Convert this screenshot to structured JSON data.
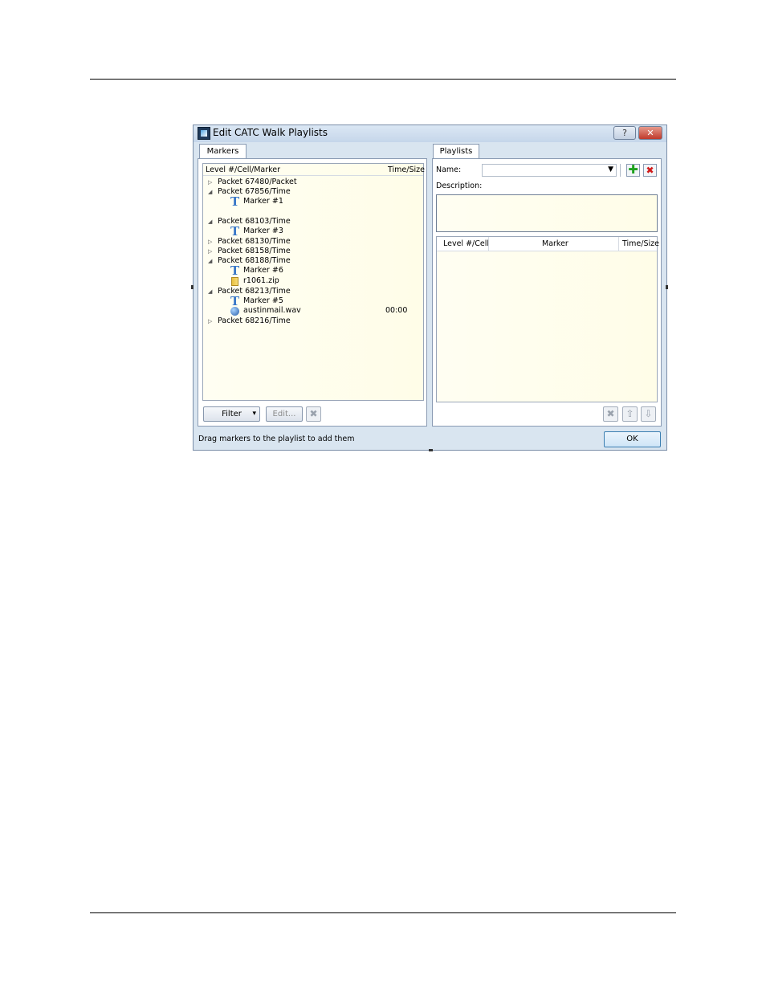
{
  "window": {
    "title": "Edit CATC Walk Playlists",
    "help_label": "?",
    "close_label": "✕"
  },
  "markers_panel": {
    "tab_label": "Markers",
    "columns": {
      "level": "Level #/Cell/Marker",
      "time": "Time/Size"
    },
    "rows": [
      {
        "kind": "packet",
        "expander": "▷",
        "label": "Packet 67480/Packet",
        "time": ""
      },
      {
        "kind": "packet",
        "expander": "◢",
        "label": "Packet 67856/Time",
        "time": ""
      },
      {
        "kind": "marker",
        "label": "Marker #1",
        "time": ""
      },
      {
        "kind": "packet",
        "expander": "◢",
        "label": "Packet 68103/Time",
        "time": ""
      },
      {
        "kind": "marker",
        "label": "Marker #3",
        "time": ""
      },
      {
        "kind": "packet",
        "expander": "▷",
        "label": "Packet 68130/Time",
        "time": ""
      },
      {
        "kind": "packet",
        "expander": "▷",
        "label": "Packet 68158/Time",
        "time": ""
      },
      {
        "kind": "packet",
        "expander": "◢",
        "label": "Packet 68188/Time",
        "time": ""
      },
      {
        "kind": "marker",
        "label": "Marker #6",
        "time": ""
      },
      {
        "kind": "zip",
        "label": "r1061.zip",
        "time": ""
      },
      {
        "kind": "packet",
        "expander": "◢",
        "label": "Packet 68213/Time",
        "time": ""
      },
      {
        "kind": "marker",
        "label": "Marker #5",
        "time": ""
      },
      {
        "kind": "wav",
        "label": "austinmail.wav",
        "time": "00:00"
      },
      {
        "kind": "packet",
        "expander": "▷",
        "label": "Packet 68216/Time",
        "time": ""
      }
    ],
    "filter_label": "Filter",
    "filter_arrow": "▾",
    "edit_label": "Edit...",
    "delete_glyph": "✖"
  },
  "playlists_panel": {
    "tab_label": "Playlists",
    "name_label": "Name:",
    "name_value": "",
    "name_arrow": "▼",
    "add_glyph": "✚",
    "remove_glyph": "✖",
    "description_label": "Description:",
    "description_value": "",
    "columns": {
      "level": "Level #/Cell",
      "marker": "Marker",
      "time": "Time/Size"
    },
    "delete_glyph": "✖",
    "up_glyph": "⇧",
    "down_glyph": "⇩"
  },
  "status_text": "Drag markers to the playlist to add them",
  "ok_label": "OK"
}
